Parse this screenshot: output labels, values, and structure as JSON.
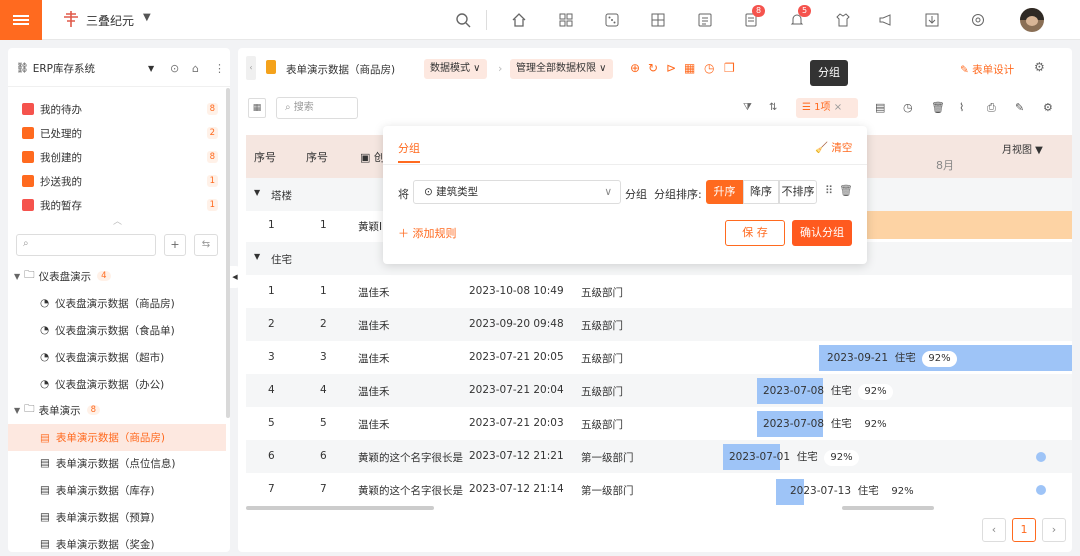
{
  "brand": {
    "name": "三叠纪元"
  },
  "topbar": {
    "badge_tasks": "8",
    "badge_bell": "5"
  },
  "sidebar": {
    "title": "ERP库存系统",
    "quick": [
      {
        "label": "我的待办",
        "count": "8"
      },
      {
        "label": "已处理的",
        "count": "2"
      },
      {
        "label": "我创建的",
        "count": "8"
      },
      {
        "label": "抄送我的",
        "count": "1"
      },
      {
        "label": "我的暂存",
        "count": "1"
      }
    ],
    "search_placeholder": "",
    "groups": [
      {
        "label": "仪表盘演示",
        "count": "4",
        "items": [
          "仪表盘演示数据（商品房)",
          "仪表盘演示数据（食品单)",
          "仪表盘演示数据（超市)",
          "仪表盘演示数据（办公)"
        ]
      },
      {
        "label": "表单演示",
        "count": "8",
        "items": [
          "表单演示数据（商品房)",
          "表单演示数据（点位信息)",
          "表单演示数据（库存)",
          "表单演示数据（预算)",
          "表单演示数据（奖金)"
        ]
      }
    ]
  },
  "breadcrumb": {
    "current": "表单演示数据（商品房)",
    "mode": "数据模式",
    "perm": "管理全部数据权限"
  },
  "toolbar": {
    "form_design": "表单设计",
    "search_placeholder": "搜索",
    "group_chip": "1项",
    "tooltip": "分组"
  },
  "table": {
    "headers": [
      "序号",
      "序号",
      "创"
    ],
    "view": "月视图",
    "month": "8月",
    "groups": [
      {
        "label": "塔楼"
      },
      {
        "label": "住宅"
      }
    ],
    "tower_row": {
      "idx": "1",
      "no": "1",
      "name": "黄颖I"
    },
    "rows": [
      {
        "idx": "1",
        "no": "1",
        "name": "温佳禾",
        "time": "2023-10-08 10:49",
        "dept": "五级部门"
      },
      {
        "idx": "2",
        "no": "2",
        "name": "温佳禾",
        "time": "2023-09-20 09:48",
        "dept": "五级部门"
      },
      {
        "idx": "3",
        "no": "3",
        "name": "温佳禾",
        "time": "2023-07-21 20:05",
        "dept": "五级部门"
      },
      {
        "idx": "4",
        "no": "4",
        "name": "温佳禾",
        "time": "2023-07-21 20:04",
        "dept": "五级部门"
      },
      {
        "idx": "5",
        "no": "5",
        "name": "温佳禾",
        "time": "2023-07-21 20:03",
        "dept": "五级部门"
      },
      {
        "idx": "6",
        "no": "6",
        "name": "黄颖的这个名字很长是",
        "time": "2023-07-12 21:21",
        "dept": "第一级部门"
      },
      {
        "idx": "7",
        "no": "7",
        "name": "黄颖的这个名字很长是",
        "time": "2023-07-12 21:14",
        "dept": "第一级部门"
      }
    ],
    "bars": [
      {
        "date": "2023-09-21",
        "type": "住宅",
        "pct": "92%"
      },
      {
        "date": "2023-07-08",
        "type": "住宅",
        "pct": "92%"
      },
      {
        "date": "2023-07-08",
        "type": "住宅",
        "pct": "92%"
      },
      {
        "date": "2023-07-01",
        "type": "住宅",
        "pct": "92%"
      },
      {
        "date": "2023-07-13",
        "type": "住宅",
        "pct": "92%"
      }
    ]
  },
  "popup": {
    "tab": "分组",
    "clear": "清空",
    "prefix": "将",
    "field": "建筑类型",
    "group_word": "分组",
    "sort_label": "分组排序:",
    "asc": "升序",
    "desc": "降序",
    "none": "不排序",
    "add_rule": "添加规则",
    "save": "保 存",
    "confirm": "确认分组"
  },
  "pager": {
    "page": "1"
  },
  "colors": {
    "accent": "#ff6a1f",
    "bar_blue": "#9ec4f7",
    "bar_orange": "#fdd3a4"
  }
}
